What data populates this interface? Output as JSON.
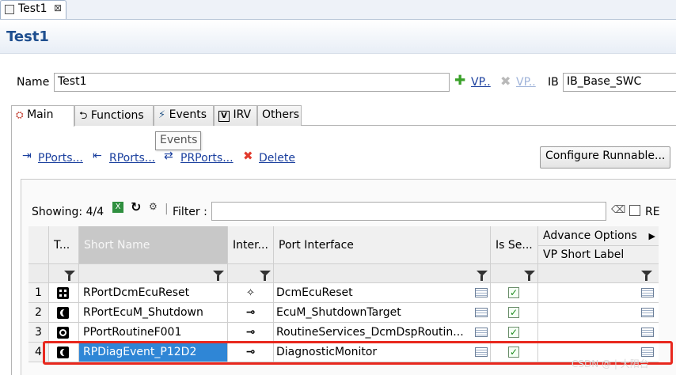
{
  "editor_tab": {
    "title": "Test1",
    "close": "⊠"
  },
  "header": {
    "title": "Test1"
  },
  "name_row": {
    "name_label": "Name",
    "name_value": "Test1",
    "vp_add": "VP..",
    "vp_remove": "VP..",
    "ib_label": "IB",
    "ib_value": "IB_Base_SWC"
  },
  "subtabs": [
    {
      "label": "Main",
      "icon": "main-icon"
    },
    {
      "label": "Functions",
      "icon": "functions-icon"
    },
    {
      "label": "Events",
      "icon": "events-icon"
    },
    {
      "label": "IRV",
      "icon": "irv-icon"
    },
    {
      "label": "Others",
      "icon": ""
    }
  ],
  "tooltip": "Events",
  "toolbar": {
    "pports": "PPorts...",
    "rports": "RPorts...",
    "prports": "PRPorts...",
    "delete": "Delete",
    "configure": "Configure Runnable..."
  },
  "table_toolbar": {
    "showing": "Showing: 4/4",
    "filter_label": "Filter :",
    "filter_value": "",
    "re_label": "RE"
  },
  "table": {
    "columns": [
      "T...",
      "Short Name",
      "Inter...",
      "Port Interface",
      "Is Se...",
      "Advance Options",
      "VP Short Label"
    ],
    "rows": [
      {
        "num": "1",
        "type": "dots-icon",
        "short_name": "RPortDcmEcuReset",
        "inter": "sparkle-icon",
        "port_interface": "DcmEcuReset",
        "is_service": true,
        "vp_short_label": ""
      },
      {
        "num": "2",
        "type": "moon-icon",
        "short_name": "RPortEcuM_Shutdown",
        "inter": "require-icon",
        "port_interface": "EcuM_ShutdownTarget",
        "is_service": true,
        "vp_short_label": ""
      },
      {
        "num": "3",
        "type": "ring-icon",
        "short_name": "PPortRoutineF001",
        "inter": "require-icon",
        "port_interface": "RoutineServices_DcmDspRoutin...",
        "is_service": true,
        "vp_short_label": ""
      },
      {
        "num": "4",
        "type": "moon-icon",
        "short_name": "RPDiagEvent_P12D2",
        "inter": "require-icon",
        "port_interface": "DiagnosticMonitor",
        "is_service": true,
        "vp_short_label": ""
      }
    ]
  },
  "watermark": "CSDN @ | 大阳台",
  "colors": {
    "link": "#1a3f9e",
    "title": "#1f4f8f",
    "selection": "#2f86d6",
    "highlight": "#e8281e"
  }
}
